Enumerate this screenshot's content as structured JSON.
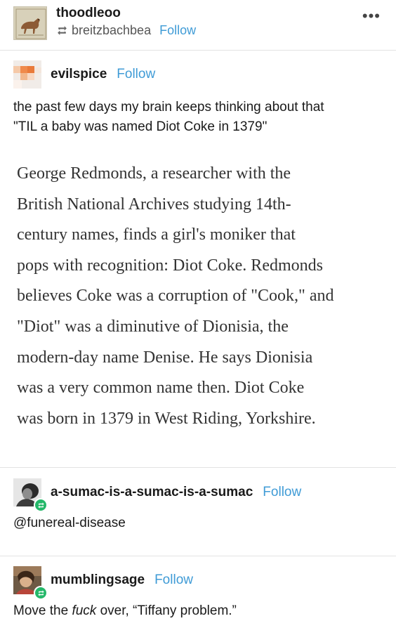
{
  "header": {
    "username": "thoodleoo",
    "reblogged_from": "breitzbachbea",
    "follow_label": "Follow",
    "menu_label": "•••"
  },
  "posts": [
    {
      "username": "evilspice",
      "follow_label": "Follow",
      "text_lines": [
        "the past few days my brain keeps thinking about that",
        "\"TIL a baby was named Diot Coke in 1379\""
      ],
      "quote_lines": [
        "George Redmonds, a researcher with the",
        "British National Archives studying 14th-",
        "century names, finds a girl's moniker that",
        "pops with recognition: Diot Coke. Redmonds",
        "believes Coke was a corruption of \"Cook,\" and",
        "\"Diot\" was a diminutive of Dionisia, the",
        "modern-day name Denise. He says Dionisia",
        "was a very common name then. Diot Coke",
        "was born in 1379 in West Riding, Yorkshire."
      ]
    },
    {
      "username": "a-sumac-is-a-sumac-is-a-sumac",
      "follow_label": "Follow",
      "text": "@funereal-disease"
    },
    {
      "username": "mumblingsage",
      "follow_label": "Follow",
      "text_before": "Move the ",
      "text_emphasis": "fuck",
      "text_after": " over, “Tiffany problem.”"
    }
  ],
  "colors": {
    "follow": "#3f9bd6",
    "reblog_badge": "#25b86a",
    "divider": "#e3e3e3"
  },
  "icons": [
    "reblog-icon",
    "more-options-icon",
    "reblog-badge-icon"
  ]
}
